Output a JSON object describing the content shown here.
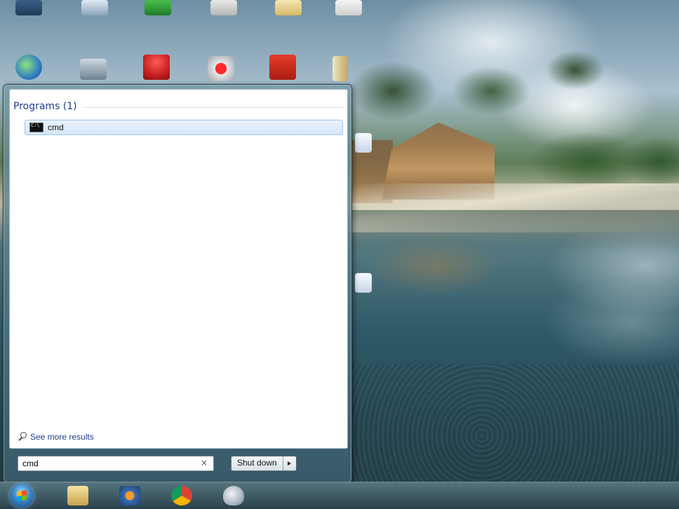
{
  "start_menu": {
    "group_title": "Programs (1)",
    "results": [
      {
        "label": "cmd",
        "icon": "command-prompt-icon"
      }
    ],
    "see_more_label": "See more results",
    "search": {
      "value": "cmd"
    },
    "clear_glyph": "×",
    "shutdown_label": "Shut down"
  },
  "taskbar": {
    "apps": [
      "windows-explorer-icon",
      "media-player-icon",
      "chrome-icon",
      "paint-icon"
    ]
  },
  "desktop_icons": [
    "hp-printer-icon",
    "network-icon",
    "red-app-icon",
    "record-app-icon",
    "filezilla-icon",
    "document-icon"
  ],
  "colors": {
    "accent_text": "#1f3d8a",
    "selection": "#d4e6f8"
  }
}
